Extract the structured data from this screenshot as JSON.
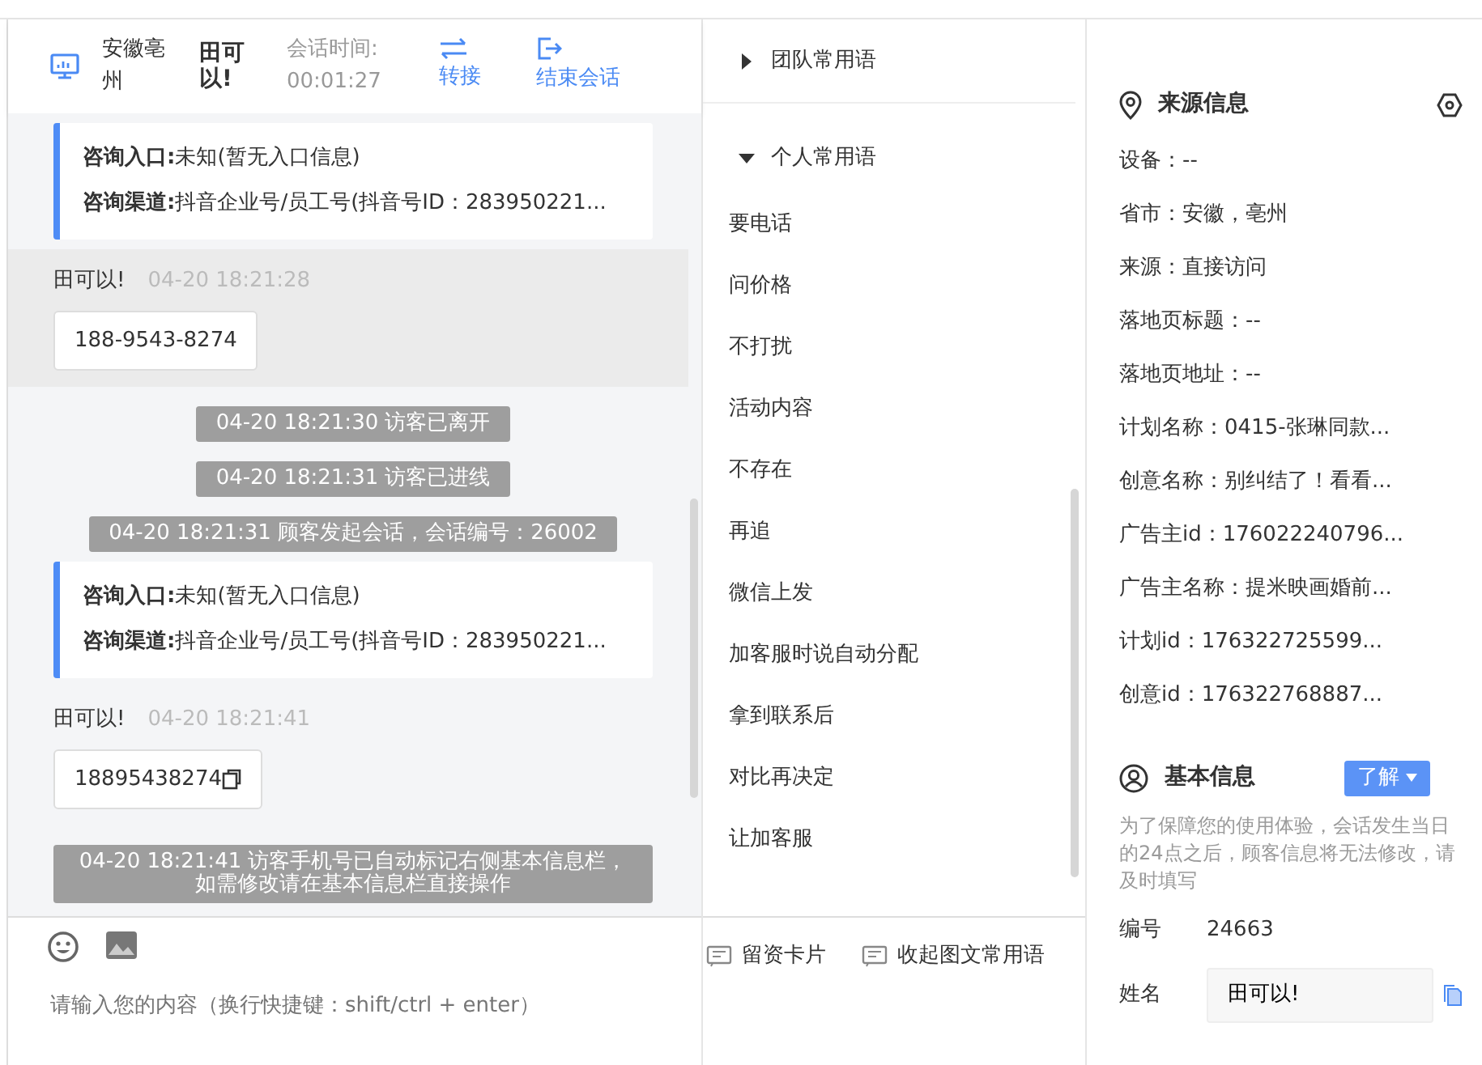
{
  "chat_header": {
    "location": "安徽亳州",
    "visitor": "田可以!",
    "timer_label": "会话时间:",
    "timer": "00:01:27",
    "actions": [
      {
        "label": "转接",
        "kind": "transfer"
      },
      {
        "label": "结束会话",
        "kind": "end"
      }
    ]
  },
  "messages": [
    {
      "kind": "info",
      "rows": [
        {
          "label": "咨询入口:",
          "value": "未知(暂无入口信息)"
        },
        {
          "label": "咨询渠道:",
          "value": "抖音企业号/员工号(抖音号ID：283950221..."
        }
      ]
    },
    {
      "kind": "visitor",
      "highlighted": true,
      "name": "田可以!",
      "time": "04-20 18:21:28",
      "text": "188-9543-8274",
      "copyable": false
    },
    {
      "kind": "system",
      "text": "04-20 18:21:30 访客已离开"
    },
    {
      "kind": "system",
      "text": "04-20 18:21:31 访客已进线"
    },
    {
      "kind": "system",
      "text": "04-20 18:21:31 顾客发起会话，会话编号：26002"
    },
    {
      "kind": "info",
      "rows": [
        {
          "label": "咨询入口:",
          "value": "未知(暂无入口信息)"
        },
        {
          "label": "咨询渠道:",
          "value": "抖音企业号/员工号(抖音号ID：283950221..."
        }
      ]
    },
    {
      "kind": "visitor",
      "highlighted": false,
      "name": "田可以!",
      "time": "04-20 18:21:41",
      "text": "18895438274",
      "copyable": true
    },
    {
      "kind": "system",
      "text": "04-20 18:21:41 访客手机号已自动标记右侧基本信息栏，如需修改请在基本信息栏直接操作"
    }
  ],
  "composer": {
    "placeholder": "请输入您的内容（换行快捷键：shift/ctrl + enter）",
    "tools": [
      {
        "label": "留资卡片"
      },
      {
        "label": "收起图文常用语"
      }
    ]
  },
  "phrases": [
    {
      "title": "团队常用语",
      "expanded": false
    },
    {
      "title": "个人常用语",
      "expanded": true,
      "items": [
        "要电话",
        "问价格",
        "不打扰",
        "活动内容",
        "不存在",
        "再追",
        "微信上发",
        "加客服时说自动分配",
        "拿到联系后",
        "对比再决定",
        "让加客服"
      ]
    }
  ],
  "source_info": {
    "title": "来源信息",
    "fields": [
      "设备：--",
      "省市：安徽，亳州",
      "来源：直接访问",
      "落地页标题：--",
      "落地页地址：--",
      "计划名称：0415-张琳同款...",
      "创意名称：别纠结了！看看...",
      "广告主id：176022240796...",
      "广告主名称：提米映画婚前...",
      "计划id：176322725599...",
      "创意id：176322768887..."
    ]
  },
  "basic_info": {
    "title": "基本信息",
    "button": "了解",
    "note": "为了保障您的使用体验，会话发生当日的24点之后，顾客信息将无法修改，请及时填写",
    "fields": [
      {
        "kind": "text",
        "label": "编号",
        "value": "24663"
      },
      {
        "kind": "input",
        "label": "姓名",
        "value": "田可以!"
      }
    ]
  }
}
